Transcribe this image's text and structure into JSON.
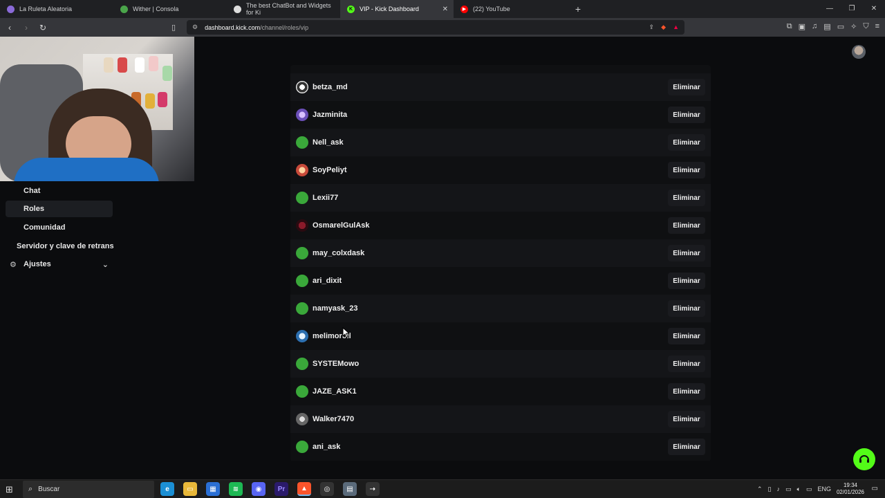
{
  "tabs": [
    {
      "title": "La Ruleta Aleatoria",
      "color": "#8a6ad8",
      "glyph": ""
    },
    {
      "title": "Wither | Consola",
      "color": "#4aa54a",
      "glyph": ""
    },
    {
      "title": "The best ChatBot and Widgets for Ki",
      "color": "#dddddd",
      "glyph": ""
    },
    {
      "title": "VIP - Kick Dashboard",
      "color": "#53fc18",
      "glyph": "K",
      "active": true
    },
    {
      "title": "(22) YouTube",
      "color": "#ff0000",
      "glyph": "▶"
    }
  ],
  "address": {
    "host": "dashboard.kick.com",
    "path": "/channel/roles/vip"
  },
  "sidebar": {
    "items": [
      {
        "label": "Chat"
      },
      {
        "label": "Roles"
      },
      {
        "label": "Comunidad"
      },
      {
        "label": "Servidor y clave de retrans"
      },
      {
        "label": "Ajustes"
      }
    ]
  },
  "vip_list": {
    "remove_label": "Eliminar",
    "users": [
      {
        "name": "betza_md",
        "avatar": "bw"
      },
      {
        "name": "Jazminita",
        "avatar": "purple"
      },
      {
        "name": "Nell_ask",
        "avatar": "green"
      },
      {
        "name": "SoyPeliyt",
        "avatar": "red"
      },
      {
        "name": "Lexii77",
        "avatar": "green"
      },
      {
        "name": "OsmarelGulAsk",
        "avatar": "dark"
      },
      {
        "name": "may_colxdask",
        "avatar": "green"
      },
      {
        "name": "ari_dixit",
        "avatar": "green"
      },
      {
        "name": "namyask_23",
        "avatar": "green"
      },
      {
        "name": "melimoroll",
        "avatar": "blue"
      },
      {
        "name": "SYSTEMowo",
        "avatar": "green"
      },
      {
        "name": "JAZE_ASK1",
        "avatar": "green"
      },
      {
        "name": "Walker7470",
        "avatar": "gray"
      },
      {
        "name": "ani_ask",
        "avatar": "green"
      }
    ]
  },
  "taskbar": {
    "search_placeholder": "Buscar",
    "lang": "ENG",
    "time": "19:34",
    "date": "02/01/2026"
  },
  "colors": {
    "accent": "#53fc18",
    "background": "#0b0c0e"
  }
}
